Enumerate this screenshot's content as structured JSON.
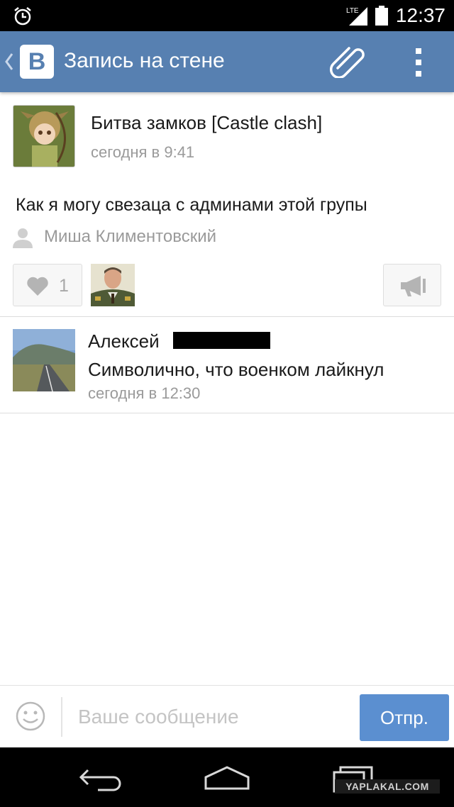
{
  "status_bar": {
    "time": "12:37",
    "network_label": "LTE",
    "icons": [
      "alarm-icon",
      "lte-signal-icon",
      "battery-icon"
    ]
  },
  "header": {
    "logo_text": "В",
    "title": "Запись на стене",
    "icons": [
      "back-chevron-icon",
      "paperclip-icon",
      "overflow-menu-icon"
    ],
    "background": "#5780b1"
  },
  "post": {
    "author": "Битва замков [Castle clash]",
    "date": "сегодня в 9:41",
    "text": "Как я могу свезаца с админами этой групы",
    "signer": "Миша Климентовский",
    "likes_count": "1"
  },
  "comment": {
    "author": "Алексей",
    "text": "Символично, что военком лайкнул",
    "date": "сегодня в 12:30"
  },
  "composer": {
    "placeholder": "Ваше сообщение",
    "value": "",
    "send_label": "Отпр.",
    "send_color": "#5b8fd0"
  },
  "nav_bar": {
    "icons": [
      "nav-back-icon",
      "nav-home-icon",
      "nav-recent-apps-icon"
    ]
  },
  "watermark": "YAPLAKAL.COM"
}
